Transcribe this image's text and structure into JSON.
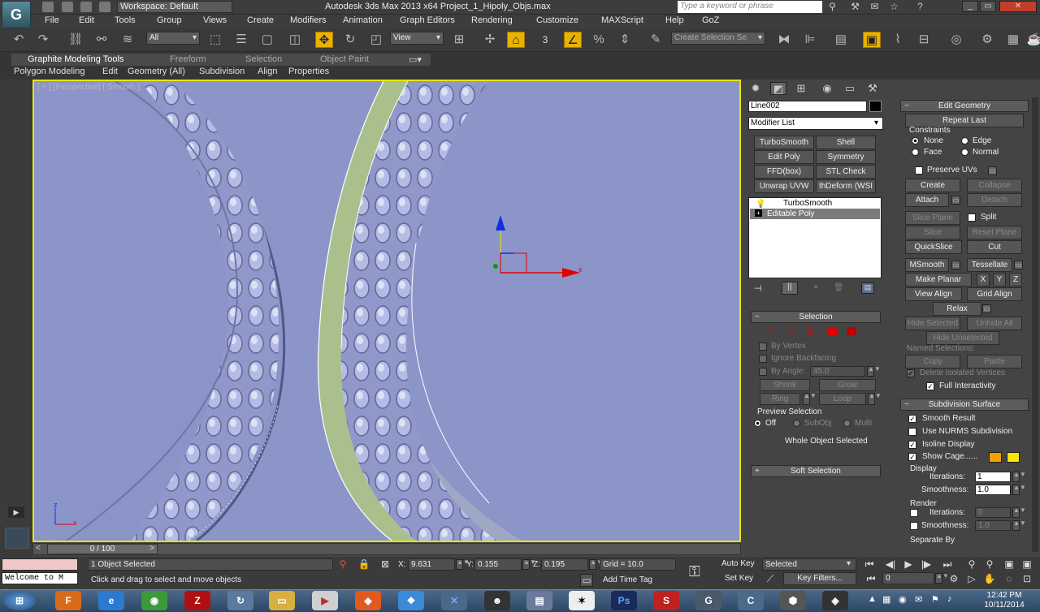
{
  "titlebar": {
    "workspace": "Workspace: Default",
    "title": "Autodesk 3ds Max  2013 x64     Project_1_Hipoly_Objs.max",
    "search_placeholder": "Type a keyword or phrase"
  },
  "menu": [
    "File",
    "Edit",
    "Tools",
    "Group",
    "Views",
    "Create",
    "Modifiers",
    "Animation",
    "Graph Editors",
    "Rendering",
    "Customize",
    "MAXScript",
    "Help",
    "GoZ"
  ],
  "toolbar": {
    "filter": "All",
    "view": "View",
    "snap_value": "3",
    "selection_set_placeholder": "Create Selection Se"
  },
  "ribbon": {
    "tabs": [
      "Graphite Modeling Tools",
      "Freeform",
      "Selection",
      "Object Paint"
    ],
    "subtabs": [
      "Polygon Modeling",
      "Edit",
      "Geometry (All)",
      "Subdivision",
      "Align",
      "Properties"
    ]
  },
  "viewport": {
    "label": "[ + ] [Perspective] [ Smooth ]",
    "axis_x": "x",
    "axis_z": "z"
  },
  "command_panel": {
    "object_name": "Line002",
    "modifier_list": "Modifier List",
    "modifier_buttons": [
      "TurboSmooth",
      "Shell",
      "Edit Poly",
      "Symmetry",
      "FFD(box)",
      "STL Check",
      "Unwrap UVW",
      "thDeform (WSI"
    ],
    "stack": [
      "TurboSmooth",
      "Editable Poly"
    ],
    "selection": {
      "title": "Selection",
      "by_vertex": "By Vertex",
      "ignore_backfacing": "Ignore Backfacing",
      "by_angle": "By Angle:",
      "angle_value": "45.0",
      "shrink": "Shrink",
      "grow": "Grow",
      "ring": "Ring",
      "loop": "Loop",
      "preview_title": "Preview Selection",
      "preview_off": "Off",
      "preview_subobj": "SubObj",
      "preview_multi": "Multi",
      "status": "Whole Object Selected"
    },
    "soft_selection": "Soft Selection"
  },
  "edit_geometry": {
    "title": "Edit Geometry",
    "repeat_last": "Repeat Last",
    "constraints": "Constraints",
    "c_none": "None",
    "c_edge": "Edge",
    "c_face": "Face",
    "c_normal": "Normal",
    "preserve_uvs": "Preserve UVs",
    "create": "Create",
    "collapse": "Collapse",
    "attach": "Attach",
    "detach": "Detach",
    "slice_plane": "Slice Plane",
    "split": "Split",
    "slice": "Slice",
    "reset_plane": "Reset Plane",
    "quickslice": "QuickSlice",
    "cut": "Cut",
    "msmooth": "MSmooth",
    "tessellate": "Tessellate",
    "make_planar": "Make Planar",
    "x": "X",
    "y": "Y",
    "z": "Z",
    "view_align": "View Align",
    "grid_align": "Grid Align",
    "relax": "Relax",
    "hide_selected": "Hide Selected",
    "unhide_all": "Unhide All",
    "hide_unselected": "Hide Unselected",
    "named_selections": "Named Selections:",
    "copy": "Copy",
    "paste": "Paste",
    "delete_isolated": "Delete Isolated Vertices",
    "full_interactivity": "Full Interactivity"
  },
  "subdivision": {
    "title": "Subdivision Surface",
    "smooth_result": "Smooth Result",
    "use_nurms": "Use NURMS Subdivision",
    "isoline": "Isoline Display",
    "show_cage": "Show Cage......",
    "display": "Display",
    "iterations_label": "Iterations:",
    "iterations": "1",
    "smoothness_label": "Smoothness:",
    "smoothness": "1.0",
    "render": "Render",
    "r_iterations": "0",
    "r_smoothness": "1.0",
    "separate_by": "Separate By",
    "cage_color_1": "#f5a000",
    "cage_color_2": "#f5e600"
  },
  "timeline": {
    "frame": "0 / 100"
  },
  "status": {
    "selected": "1 Object Selected",
    "prompt": "Click and drag to select and move objects",
    "maxscript": "Welcome to M",
    "x_label": "X:",
    "x": "9.631",
    "y_label": "Y:",
    "y": "0.155",
    "z_label": "Z:",
    "z": "0.195",
    "grid": "Grid = 10.0",
    "add_time_tag": "Add Time Tag",
    "auto_key": "Auto Key",
    "set_key": "Set Key",
    "key_mode": "Selected",
    "key_filters": "Key Filters...",
    "frame_field": "0"
  },
  "taskbar": {
    "time": "12:42 PM",
    "date": "10/11/2014"
  }
}
